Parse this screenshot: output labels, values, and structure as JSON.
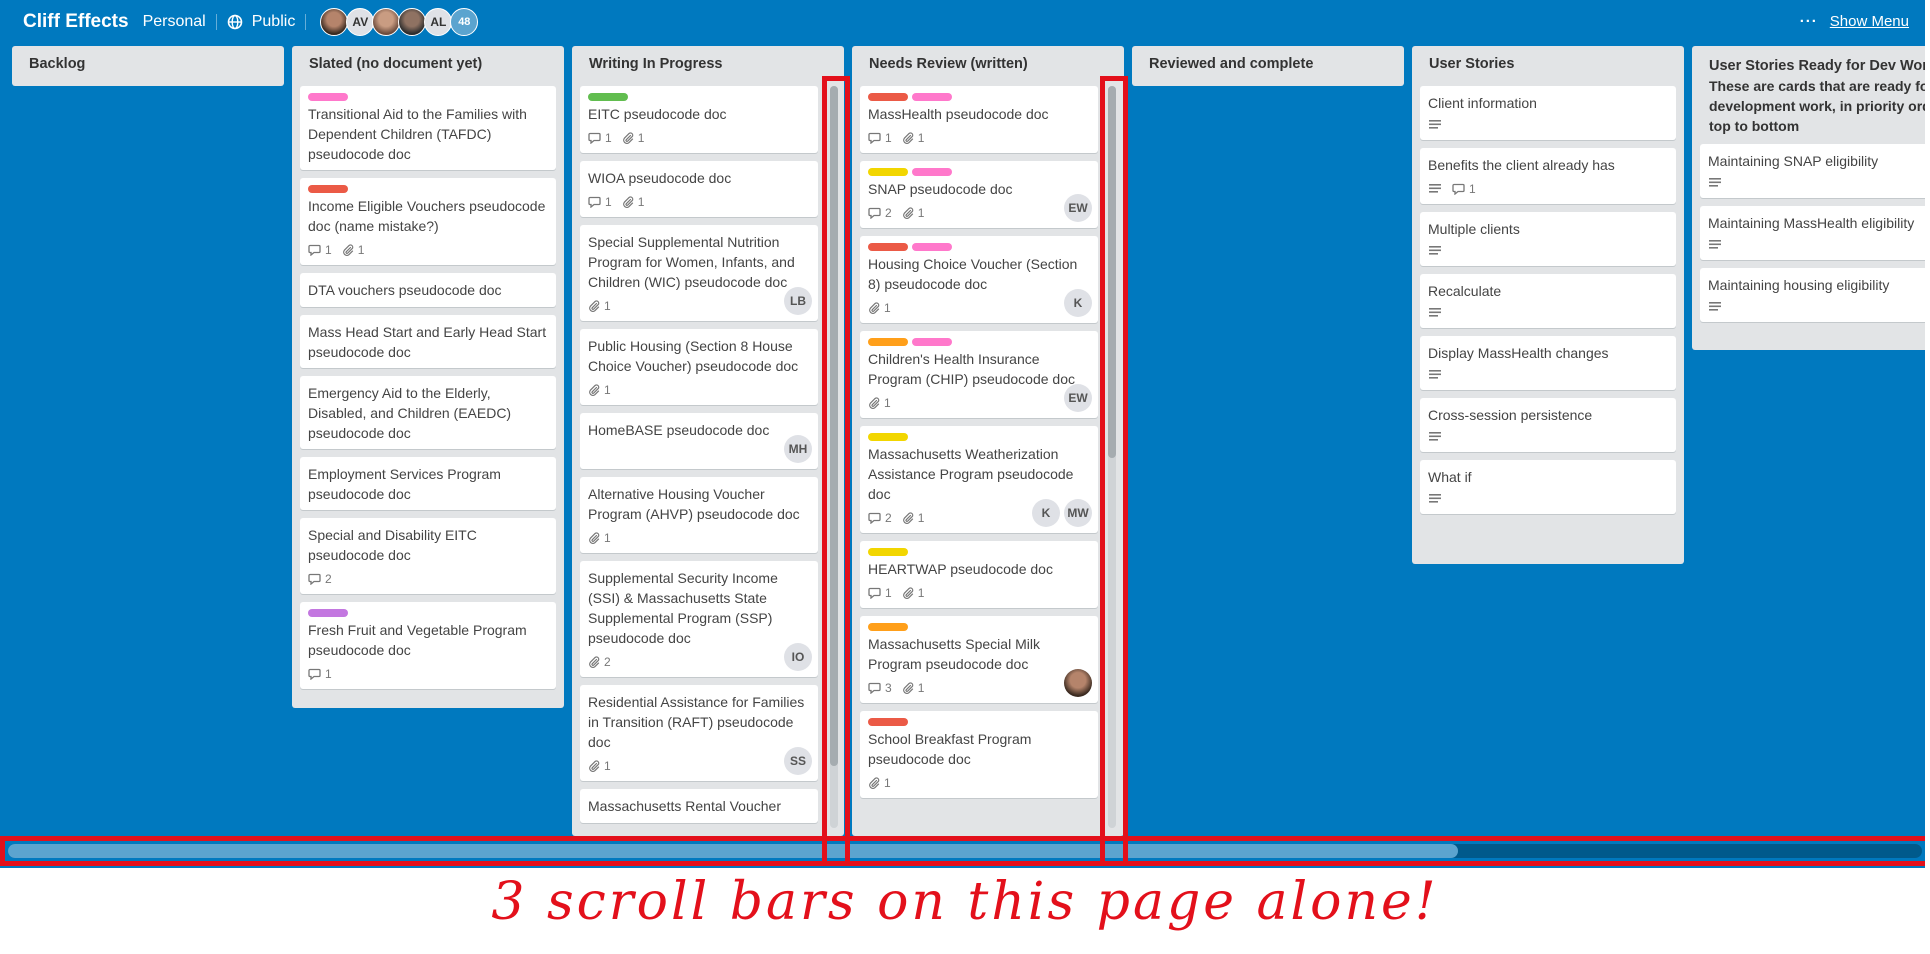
{
  "header": {
    "board_title": "Cliff Effects",
    "workspace": "Personal",
    "visibility": "Public",
    "members": [
      "photo",
      "AV",
      "photo",
      "photo",
      "AL"
    ],
    "member_count": "48",
    "show_menu_dots": "···",
    "show_menu_label": "Show Menu"
  },
  "colors": {
    "board_bg": "#0079bf",
    "green": "#61bd4f",
    "pink": "#ff78cb",
    "red": "#eb5a46",
    "yellow": "#f2d600",
    "orange": "#ff9f1a",
    "purple": "#c377e0",
    "annotation": "#e3101b"
  },
  "lists": [
    {
      "title": "Backlog",
      "cards": []
    },
    {
      "title": "Slated (no document yet)",
      "cards": [
        {
          "labels": [
            "pink"
          ],
          "title": "Transitional Aid to the Families with Dependent Children (TAFDC) pseudocode doc"
        },
        {
          "labels": [
            "red"
          ],
          "title": "Income Eligible Vouchers pseudocode doc (name mistake?)",
          "comments": "1",
          "attachments": "1"
        },
        {
          "title": "DTA vouchers pseudocode doc"
        },
        {
          "title": "Mass Head Start and Early Head Start pseudocode doc"
        },
        {
          "title": "Emergency Aid to the Elderly, Disabled, and Children (EAEDC) pseudocode doc"
        },
        {
          "title": "Employment Services Program pseudocode doc"
        },
        {
          "title": "Special and Disability EITC pseudocode doc",
          "comments": "2"
        },
        {
          "labels": [
            "purple"
          ],
          "title": "Fresh Fruit and Vegetable Program pseudocode doc",
          "comments": "1"
        }
      ]
    },
    {
      "title": "Writing In Progress",
      "cards": [
        {
          "labels": [
            "green"
          ],
          "title": "EITC pseudocode doc",
          "comments": "1",
          "attachments": "1"
        },
        {
          "title": "WIOA pseudocode doc",
          "comments": "1",
          "attachments": "1"
        },
        {
          "title": "Special Supplemental Nutrition Program for Women, Infants, and Children (WIC) pseudocode doc",
          "attachments": "1",
          "avatars": [
            "LB"
          ]
        },
        {
          "title": "Public Housing (Section 8 House Choice Voucher) pseudocode doc",
          "attachments": "1"
        },
        {
          "title": "HomeBASE pseudocode doc",
          "avatars": [
            "MH"
          ]
        },
        {
          "title": "Alternative Housing Voucher Program (AHVP) pseudocode doc",
          "attachments": "1"
        },
        {
          "title": "Supplemental Security Income (SSI) & Massachusetts State Supplemental Program (SSP) pseudocode doc",
          "attachments": "2",
          "avatars": [
            "IO"
          ]
        },
        {
          "title": "Residential Assistance for Families in Transition (RAFT) pseudocode doc",
          "attachments": "1",
          "avatars": [
            "SS"
          ]
        },
        {
          "title": "Massachusetts Rental Voucher"
        }
      ]
    },
    {
      "title": "Needs Review (written)",
      "cards": [
        {
          "labels": [
            "red",
            "pink"
          ],
          "title": "MassHealth pseudocode doc",
          "comments": "1",
          "attachments": "1"
        },
        {
          "labels": [
            "yellow",
            "pink"
          ],
          "title": "SNAP pseudocode doc",
          "comments": "2",
          "attachments": "1",
          "avatars": [
            "EW"
          ]
        },
        {
          "labels": [
            "red",
            "pink"
          ],
          "title": "Housing Choice Voucher (Section 8) pseudocode doc",
          "attachments": "1",
          "avatars": [
            "K"
          ]
        },
        {
          "labels": [
            "orange",
            "pink"
          ],
          "title": "Children's Health Insurance Program (CHIP) pseudocode doc",
          "attachments": "1",
          "avatars": [
            "EW"
          ]
        },
        {
          "labels": [
            "yellow"
          ],
          "title": "Massachusetts Weatherization Assistance Program pseudocode doc",
          "comments": "2",
          "attachments": "1",
          "avatars": [
            "K",
            "MW"
          ]
        },
        {
          "labels": [
            "yellow"
          ],
          "title": "HEARTWAP pseudocode doc",
          "comments": "1",
          "attachments": "1"
        },
        {
          "labels": [
            "orange"
          ],
          "title": "Massachusetts Special Milk Program pseudocode doc",
          "comments": "3",
          "attachments": "1",
          "avatars": [
            "photo"
          ]
        },
        {
          "labels": [
            "red"
          ],
          "title": "School Breakfast Program pseudocode doc",
          "attachments": "1"
        }
      ]
    },
    {
      "title": "Reviewed and complete",
      "cards": []
    },
    {
      "title": "User Stories",
      "cards": [
        {
          "title": "Client information",
          "description": true
        },
        {
          "title": "Benefits the client already has",
          "description": true,
          "comments": "1"
        },
        {
          "title": "Multiple clients",
          "description": true
        },
        {
          "title": "Recalculate",
          "description": true
        },
        {
          "title": "Display MassHealth changes",
          "description": true
        },
        {
          "title": "Cross-session persistence",
          "description": true
        },
        {
          "title": "What if",
          "description": true
        }
      ]
    },
    {
      "title": "User Stories Ready for Dev Work",
      "title_desc": [
        "These are cards that are ready fo",
        "development work, in priority ord",
        "top to bottom"
      ],
      "cards": [
        {
          "title": "Maintaining SNAP eligibility",
          "description": true
        },
        {
          "title": "Maintaining MassHealth eligibility",
          "description": true
        },
        {
          "title": "Maintaining housing eligibility",
          "description": true
        }
      ]
    }
  ],
  "annotation": {
    "text": "3 scroll bars on this page alone!"
  }
}
